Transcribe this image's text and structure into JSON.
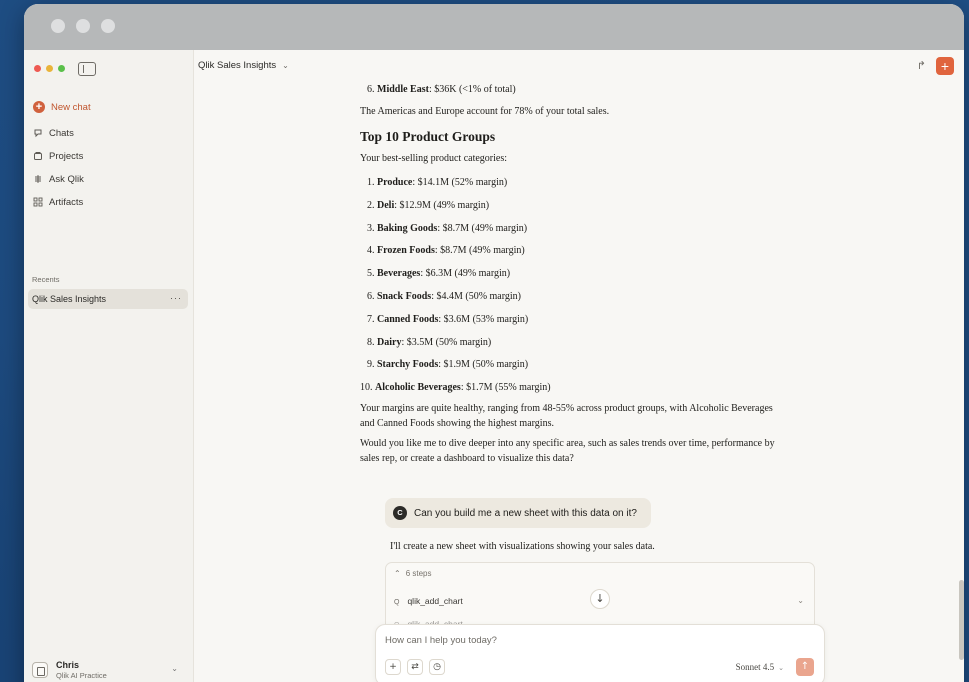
{
  "sidebar": {
    "new_chat": "New chat",
    "items": [
      {
        "label": "Chats",
        "icon": "chat-icon"
      },
      {
        "label": "Projects",
        "icon": "folder-icon"
      },
      {
        "label": "Ask Qlik",
        "icon": "qlik-icon"
      },
      {
        "label": "Artifacts",
        "icon": "artifacts-icon"
      }
    ],
    "recents_label": "Recents",
    "recent_item": "Qlik Sales Insights",
    "user": {
      "name": "Chris",
      "org": "Qlik AI Practice"
    }
  },
  "header": {
    "title": "Qlik Sales Insights"
  },
  "article": {
    "region_line": {
      "num": "6.",
      "name": "Middle East",
      "rest": ": $36K (<1% of total)"
    },
    "americas_text": "The Americas and Europe account for 78% of your total sales.",
    "heading": "Top 10 Product Groups",
    "intro": "Your best-selling product categories:",
    "products": [
      {
        "num": "1.",
        "name": "Produce",
        "rest": ": $14.1M (52% margin)"
      },
      {
        "num": "2.",
        "name": "Deli",
        "rest": ": $12.9M (49% margin)"
      },
      {
        "num": "3.",
        "name": "Baking Goods",
        "rest": ": $8.7M (49% margin)"
      },
      {
        "num": "4.",
        "name": "Frozen Foods",
        "rest": ": $8.7M (49% margin)"
      },
      {
        "num": "5.",
        "name": "Beverages",
        "rest": ": $6.3M (49% margin)"
      },
      {
        "num": "6.",
        "name": "Snack Foods",
        "rest": ": $4.4M (50% margin)"
      },
      {
        "num": "7.",
        "name": "Canned Foods",
        "rest": ": $3.6M (53% margin)"
      },
      {
        "num": "8.",
        "name": "Dairy",
        "rest": ": $3.5M (50% margin)"
      },
      {
        "num": "9.",
        "name": "Starchy Foods",
        "rest": ": $1.9M (50% margin)"
      },
      {
        "num": "10.",
        "name": "Alcoholic Beverages",
        "rest": ": $1.7M (55% margin)"
      }
    ],
    "margins_text": "Your margins are quite healthy, ranging from 48-55% across product groups, with Alcoholic Beverages and Canned Foods showing the highest margins.",
    "followup_text": "Would you like me to dive deeper into any specific area, such as sales trends over time, performance by sales rep, or create a dashboard to visualize this data?"
  },
  "user_message": {
    "avatar": "C",
    "text": "Can you build me a new sheet with this data on it?"
  },
  "reply": "I'll create a new sheet with visualizations showing your sales data.",
  "steps": {
    "header": "6 steps",
    "rows": [
      "qlik_add_chart",
      "qlik_add_chart"
    ]
  },
  "composer": {
    "placeholder": "How can I help you today?",
    "model": "Sonnet 4.5"
  },
  "colors": {
    "accent": "#e0643d",
    "desktop": "#1d4a7e"
  }
}
